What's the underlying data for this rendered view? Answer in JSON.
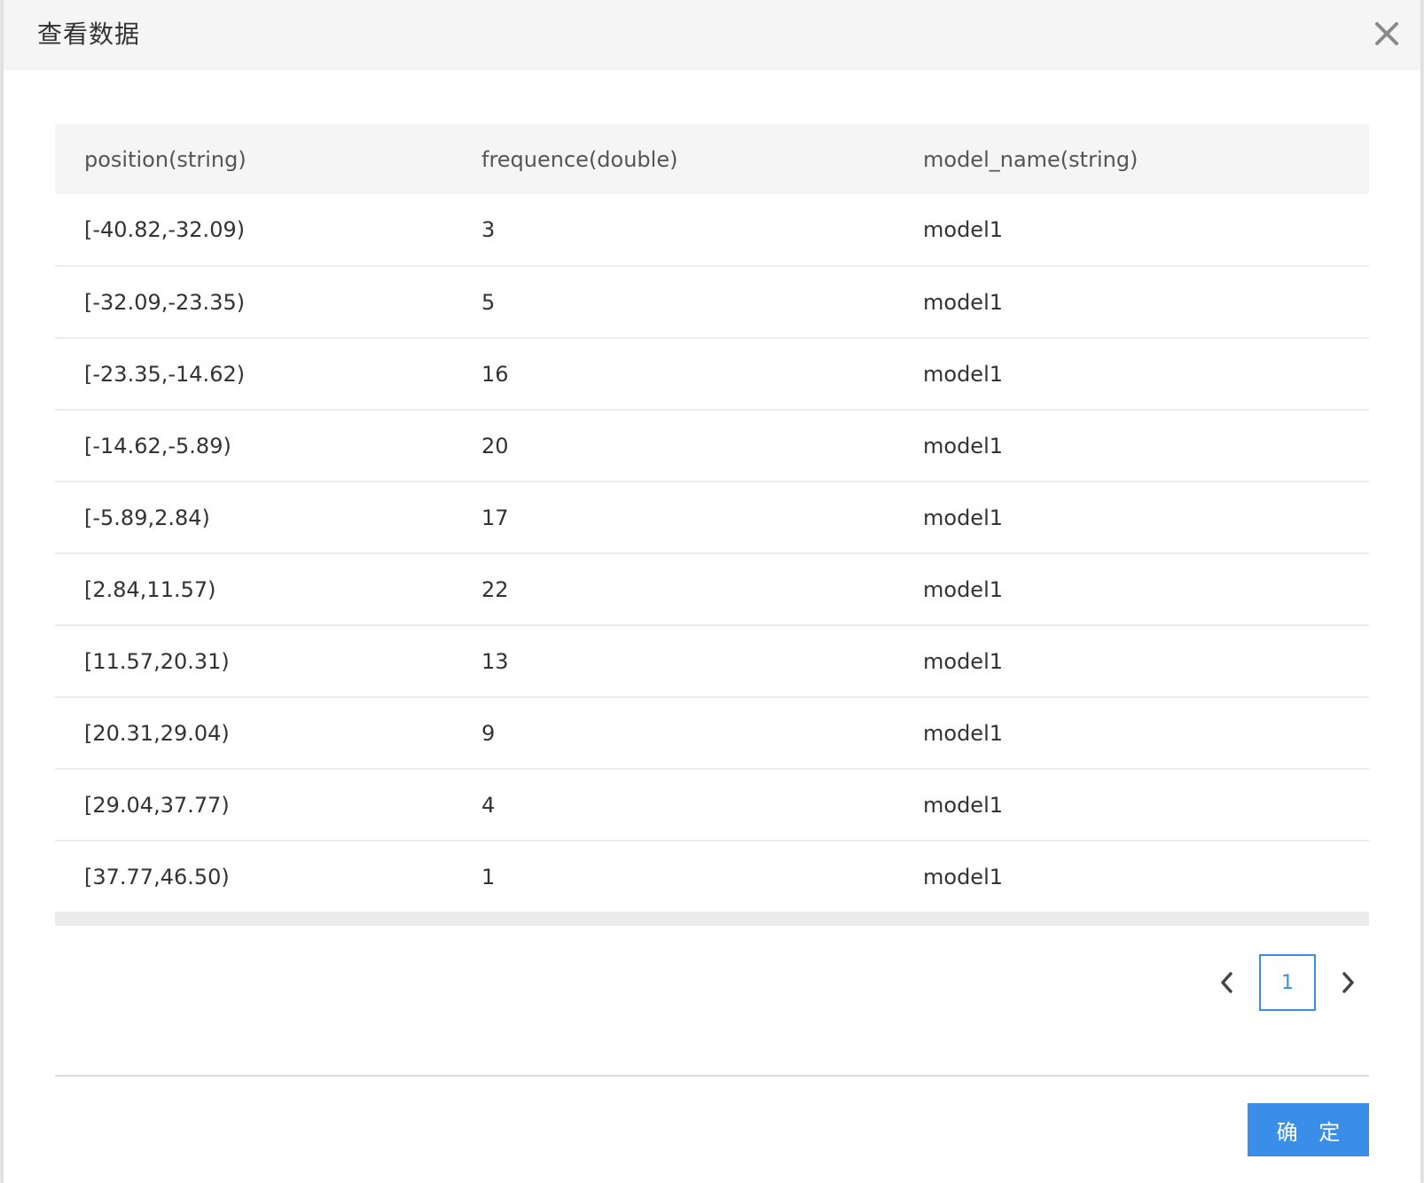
{
  "dialog": {
    "title": "查看数据"
  },
  "table": {
    "columns": [
      "position(string)",
      "frequence(double)",
      "model_name(string)"
    ],
    "rows": [
      [
        "[-40.82,-32.09)",
        "3",
        "model1"
      ],
      [
        "[-32.09,-23.35)",
        "5",
        "model1"
      ],
      [
        "[-23.35,-14.62)",
        "16",
        "model1"
      ],
      [
        "[-14.62,-5.89)",
        "20",
        "model1"
      ],
      [
        "[-5.89,2.84)",
        "17",
        "model1"
      ],
      [
        "[2.84,11.57)",
        "22",
        "model1"
      ],
      [
        "[11.57,20.31)",
        "13",
        "model1"
      ],
      [
        "[20.31,29.04)",
        "9",
        "model1"
      ],
      [
        "[29.04,37.77)",
        "4",
        "model1"
      ],
      [
        "[37.77,46.50)",
        "1",
        "model1"
      ]
    ]
  },
  "pagination": {
    "current_page": "1"
  },
  "footer": {
    "ok_label": "确 定"
  },
  "colors": {
    "accent": "#3b8ee8",
    "header_bg": "#f5f5f5"
  }
}
